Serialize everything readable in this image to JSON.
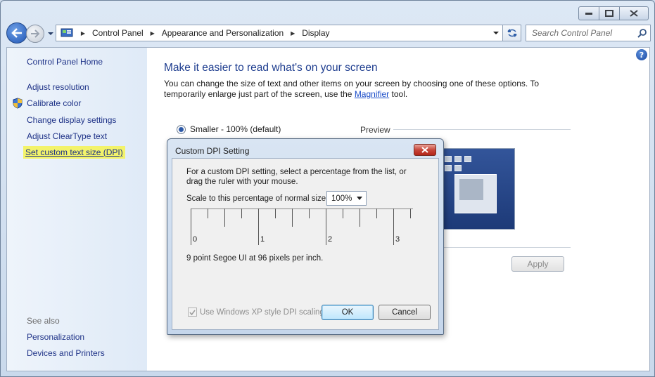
{
  "window": {
    "caption_buttons": [
      "minimize-icon",
      "maximize-icon",
      "close-icon"
    ]
  },
  "navbar": {
    "breadcrumbs": [
      "Control Panel",
      "Appearance and Personalization",
      "Display"
    ],
    "search_placeholder": "Search Control Panel"
  },
  "sidebar": {
    "home": "Control Panel Home",
    "tasks": [
      "Adjust resolution",
      "Calibrate color",
      "Change display settings",
      "Adjust ClearType text",
      "Set custom text size (DPI)"
    ],
    "see_also_label": "See also",
    "see_also": [
      "Personalization",
      "Devices and Printers"
    ],
    "highlight_color": "#f3f36a"
  },
  "main": {
    "title": "Make it easier to read what's on your screen",
    "description_1": "You can change the size of text and other items on your screen by choosing one of these options. To temporarily enlarge just part of the screen, use the ",
    "magnifier_link": "Magnifier",
    "description_2": " tool.",
    "option_smaller": "Smaller - 100% (default)",
    "preview_label": "Preview",
    "apply_label": "Apply"
  },
  "dialog": {
    "title": "Custom DPI Setting",
    "instructions": "For a custom DPI setting, select a percentage from the list, or drag the ruler with your mouse.",
    "scale_label": "Scale to this percentage of normal size:",
    "scale_value": "100%",
    "ruler_labels": [
      "0",
      "1",
      "2",
      "3"
    ],
    "dpi_info": "9 point Segoe UI at 96 pixels per inch.",
    "xp_checkbox_label": "Use Windows XP style DPI scaling",
    "xp_checked": true,
    "ok_label": "OK",
    "cancel_label": "Cancel"
  }
}
